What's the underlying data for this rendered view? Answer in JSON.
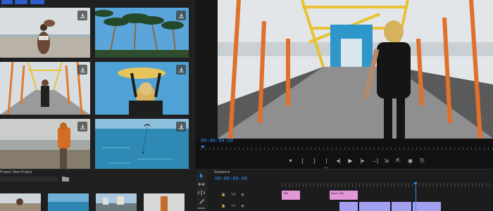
{
  "stock": {
    "tags": [
      "",
      "",
      ""
    ],
    "thumbs": [
      {
        "name": "couple-beach",
        "colors": [
          "#cfd7da",
          "#b7b2a8",
          "#6b4a3a"
        ]
      },
      {
        "name": "palm-trees",
        "colors": [
          "#5ba8de",
          "#2a4b2f",
          "#a07a3f"
        ]
      },
      {
        "name": "bridge-walk",
        "colors": [
          "#dbe0e4",
          "#e07a2c",
          "#2b2b2b"
        ]
      },
      {
        "name": "surfer-board",
        "colors": [
          "#4b9fd4",
          "#e5c25a",
          "#222"
        ]
      },
      {
        "name": "beach-runner",
        "colors": [
          "#c9cbc9",
          "#8a8070",
          "#d5712a"
        ]
      },
      {
        "name": "kite-ocean",
        "colors": [
          "#6aa9cf",
          "#2f8bb2",
          "#1e6f97"
        ]
      }
    ]
  },
  "program": {
    "timecode": "00:00:09:08",
    "controls": [
      "▾",
      "{",
      "}",
      "|←",
      "◂|",
      "▶",
      "|▸",
      "→|",
      "⇲",
      "⇱",
      "◉",
      "⎘"
    ]
  },
  "project": {
    "title": "Project: New Project",
    "thumbs": [
      "beach",
      "sea",
      "town",
      "runner"
    ]
  },
  "timeline": {
    "sequence_label": "Sequence",
    "timecode": "00:00:09:08",
    "v2": {
      "label": "V2",
      "clips": [
        {
          "label": "Title",
          "color": "#e397d8"
        },
        {
          "label": "Basic Title",
          "color": "#e397d8"
        }
      ]
    },
    "v1": {
      "label": "V1",
      "clips": [
        {
          "label": "",
          "color": "#a3a0f0"
        },
        {
          "label": "",
          "color": "#a3a0f0"
        },
        {
          "label": "",
          "color": "#a3a0f0"
        },
        {
          "label": "",
          "color": "#a3a0f0"
        }
      ]
    },
    "accent": "#2d8ceb"
  }
}
